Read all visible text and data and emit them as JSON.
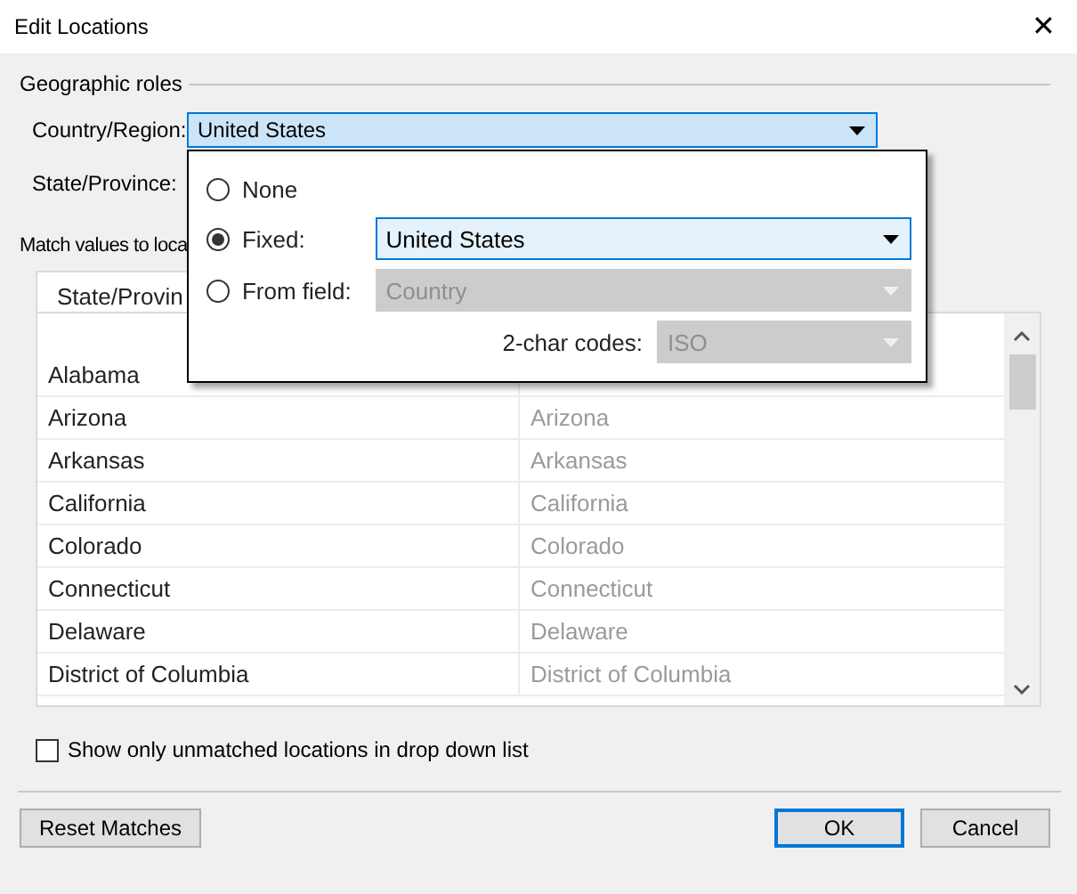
{
  "window": {
    "title": "Edit Locations",
    "close": "✕"
  },
  "geographic_roles": {
    "title": "Geographic roles",
    "country_region": {
      "label": "Country/Region:",
      "value": "United States",
      "expanded": true
    },
    "state_province": {
      "label": "State/Province:"
    }
  },
  "match_section": {
    "title": "Match values to loca",
    "tab": "State/Provin"
  },
  "popup": {
    "options": [
      {
        "label": "None",
        "selected": false
      },
      {
        "label": "Fixed:",
        "selected": true,
        "combo": {
          "value": "United States",
          "disabled": false
        }
      },
      {
        "label": "From field:",
        "selected": false,
        "combo": {
          "value": "Country",
          "disabled": true
        }
      }
    ],
    "codes": {
      "label": "2-char codes:",
      "value": "ISO",
      "disabled": true
    }
  },
  "rows": [
    {
      "location": "Alabama"
    },
    {
      "location": "Arizona",
      "match": "Arizona"
    },
    {
      "location": "Arkansas",
      "match": "Arkansas"
    },
    {
      "location": "California",
      "match": "California"
    },
    {
      "location": "Colorado",
      "match": "Colorado"
    },
    {
      "location": "Connecticut",
      "match": "Connecticut"
    },
    {
      "location": "Delaware",
      "match": "Delaware"
    },
    {
      "location": "District of Columbia",
      "match": "District of Columbia"
    }
  ],
  "unmatched_only": {
    "label": "Show only unmatched locations in drop down list",
    "checked": false
  },
  "buttons": [
    {
      "label": "Reset Matches",
      "default": false
    },
    {
      "label": "OK",
      "default": true
    },
    {
      "label": "Cancel",
      "default": false
    }
  ]
}
